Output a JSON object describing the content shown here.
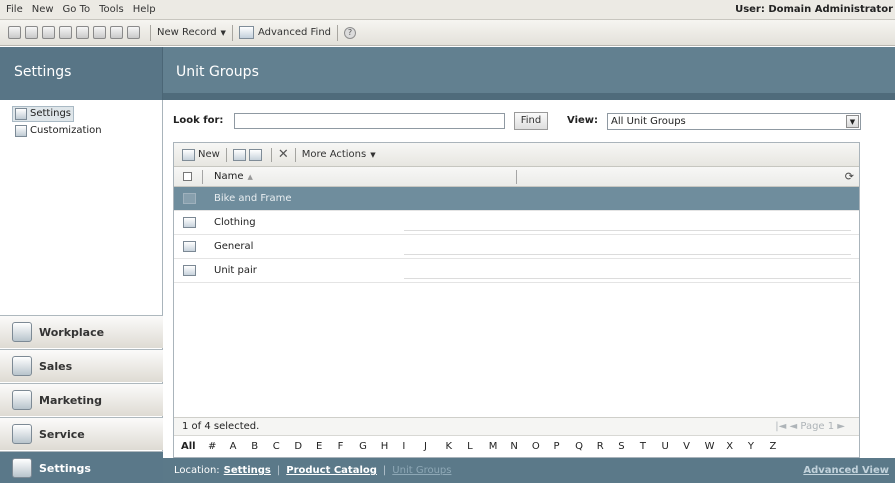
{
  "menu": {
    "items": [
      "File",
      "New",
      "Go To",
      "Tools",
      "Help"
    ],
    "user_label": "User: Domain Administrator"
  },
  "toolbar": {
    "new_record": "New Record",
    "advanced_find": "Advanced Find"
  },
  "header": {
    "area_title": "Settings",
    "page_title": "Unit Groups"
  },
  "leftnav": {
    "items": [
      {
        "label": "Settings",
        "selected": true
      },
      {
        "label": "Customization",
        "selected": false
      }
    ],
    "workspaces": [
      "Workplace",
      "Sales",
      "Marketing",
      "Service",
      "Settings"
    ],
    "active_workspace": "Settings"
  },
  "search": {
    "look_for_label": "Look for:",
    "value": "",
    "find_label": "Find",
    "view_label": "View:",
    "view_value": "All Unit Groups"
  },
  "grid": {
    "toolbar": {
      "new_label": "New",
      "more_actions": "More Actions"
    },
    "column": "Name",
    "rows": [
      {
        "name": "Bike and Frame",
        "selected": true
      },
      {
        "name": "Clothing",
        "selected": false
      },
      {
        "name": "General",
        "selected": false
      },
      {
        "name": "Unit pair",
        "selected": false
      }
    ],
    "status": "1 of 4 selected.",
    "pager": "Page 1",
    "alpha": [
      "All",
      "#",
      "A",
      "B",
      "C",
      "D",
      "E",
      "F",
      "G",
      "H",
      "I",
      "J",
      "K",
      "L",
      "M",
      "N",
      "O",
      "P",
      "Q",
      "R",
      "S",
      "T",
      "U",
      "V",
      "W",
      "X",
      "Y",
      "Z"
    ]
  },
  "footer": {
    "location_label": "Location:",
    "crumbs": [
      "Settings",
      "Product Catalog",
      "Unit Groups"
    ],
    "advanced_view": "Advanced View"
  },
  "colors": {
    "header_band": "#628090",
    "active_workspace": "#5a7889",
    "selected_row": "#6f8d9d"
  },
  "icons": {
    "delete": "delete-icon",
    "refresh": "refresh-icon",
    "help": "help-icon",
    "sort": "sort-asc-icon"
  }
}
